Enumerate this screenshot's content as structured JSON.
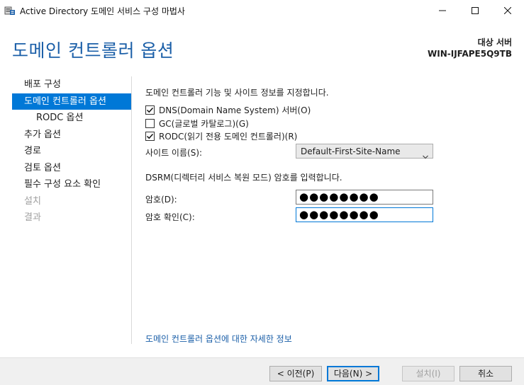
{
  "window": {
    "title": "Active Directory 도메인 서비스 구성 마법사"
  },
  "header": {
    "page_title": "도메인 컨트롤러 옵션",
    "target_label": "대상 서버",
    "target_server": "WIN-IJFAPE5Q9TB"
  },
  "sidebar": {
    "items": [
      {
        "label": "배포 구성",
        "state": "normal"
      },
      {
        "label": "도메인 컨트롤러 옵션",
        "state": "active"
      },
      {
        "label": "RODC 옵션",
        "state": "sub"
      },
      {
        "label": "추가 옵션",
        "state": "normal"
      },
      {
        "label": "경로",
        "state": "normal"
      },
      {
        "label": "검토 옵션",
        "state": "normal"
      },
      {
        "label": "필수 구성 요소 확인",
        "state": "normal"
      },
      {
        "label": "설치",
        "state": "disabled"
      },
      {
        "label": "결과",
        "state": "disabled"
      }
    ]
  },
  "main": {
    "heading": "도메인 컨트롤러 기능 및 사이트 정보를 지정합니다.",
    "checkboxes": [
      {
        "label": "DNS(Domain Name System) 서버(O)",
        "checked": true
      },
      {
        "label": "GC(글로벌 카탈로그)(G)",
        "checked": false
      },
      {
        "label": "RODC(읽기 전용 도메인 컨트롤러)(R)",
        "checked": true
      }
    ],
    "site_label": "사이트 이름(S):",
    "site_value": "Default-First-Site-Name",
    "dsrm_heading": "DSRM(디렉터리 서비스 복원 모드) 암호를 입력합니다.",
    "password_label": "암호(D):",
    "password_value": "●●●●●●●●",
    "confirm_label": "암호 확인(C):",
    "confirm_value": "●●●●●●●●",
    "more_info_link": "도메인 컨트롤러 옵션에 대한 자세한 정보"
  },
  "footer": {
    "prev_label": "< 이전(P)",
    "next_label": "다음(N) >",
    "install_label": "설치(I)",
    "cancel_label": "취소"
  },
  "colors": {
    "accent": "#0078d7",
    "title_blue": "#1b5fa8"
  }
}
